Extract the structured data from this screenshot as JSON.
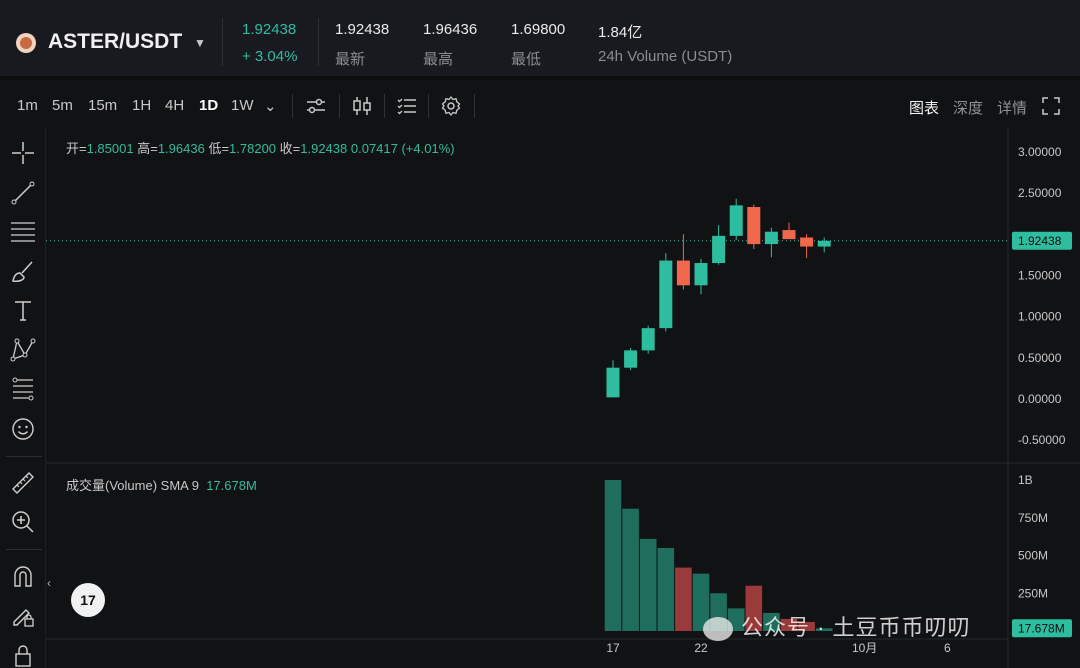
{
  "header": {
    "pair": "ASTER/USDT",
    "last_price": "1.92438",
    "change_pct": "+ 3.04%",
    "stats": [
      {
        "value": "1.92438",
        "label": "最新"
      },
      {
        "value": "1.96436",
        "label": "最高"
      },
      {
        "value": "1.69800",
        "label": "最低"
      },
      {
        "value": "1.84亿",
        "label": "24h Volume (USDT)"
      }
    ]
  },
  "toolbar": {
    "timeframes": [
      "1m",
      "5m",
      "15m",
      "1H",
      "4H",
      "1D",
      "1W"
    ],
    "active_timeframe": "1D",
    "view_tabs": [
      "图表",
      "深度",
      "详情"
    ],
    "active_view": "图表"
  },
  "legend": {
    "open_label": "开=",
    "open": "1.85001",
    "high_label": "高=",
    "high": "1.96436",
    "low_label": "低=",
    "low": "1.78200",
    "close_label": "收=",
    "close": "1.92438",
    "change": "0.07417 (+4.01%)"
  },
  "volume_legend": {
    "title": "成交量(Volume)",
    "sma_label": "SMA 9",
    "sma_value": "17.678M"
  },
  "price_axis": {
    "ticks": [
      "3.00000",
      "2.50000",
      "2.00000",
      "1.50000",
      "1.00000",
      "0.50000",
      "0.00000",
      "-0.50000"
    ],
    "current_label": "1.92438"
  },
  "volume_axis": {
    "ticks": [
      "1B",
      "750M",
      "500M",
      "250M"
    ],
    "current_label": "17.678M"
  },
  "time_axis": {
    "ticks": [
      "17",
      "22",
      "10月",
      "6"
    ]
  },
  "watermark": "公众号 · 土豆币币叨叨",
  "tv_logo": "17",
  "colors": {
    "up": "#2ebd9f",
    "down": "#f0674c",
    "vol_up": "#1f6d5c",
    "vol_down": "#9b3a3a",
    "background": "#111214",
    "header_bg": "#181a20"
  },
  "chart_data": {
    "type": "candlestick",
    "x": [
      "9-17",
      "9-18",
      "9-19",
      "9-20",
      "9-21",
      "9-22",
      "9-23",
      "9-24",
      "9-25",
      "9-26",
      "9-27",
      "9-28",
      "9-29"
    ],
    "series": [
      {
        "open": 0.02,
        "high": 0.47,
        "low": 0.02,
        "close": 0.38
      },
      {
        "open": 0.38,
        "high": 0.62,
        "low": 0.35,
        "close": 0.59
      },
      {
        "open": 0.59,
        "high": 0.89,
        "low": 0.55,
        "close": 0.86
      },
      {
        "open": 0.86,
        "high": 1.77,
        "low": 0.82,
        "close": 1.68
      },
      {
        "open": 1.68,
        "high": 2.0,
        "low": 1.33,
        "close": 1.38
      },
      {
        "open": 1.38,
        "high": 1.7,
        "low": 1.27,
        "close": 1.65
      },
      {
        "open": 1.65,
        "high": 2.11,
        "low": 1.63,
        "close": 1.98
      },
      {
        "open": 1.98,
        "high": 2.43,
        "low": 1.93,
        "close": 2.35
      },
      {
        "open": 2.33,
        "high": 2.36,
        "low": 1.82,
        "close": 1.88
      },
      {
        "open": 1.88,
        "high": 2.08,
        "low": 1.72,
        "close": 2.03
      },
      {
        "open": 2.05,
        "high": 2.14,
        "low": 1.95,
        "close": 1.94
      },
      {
        "open": 1.96,
        "high": 2.0,
        "low": 1.71,
        "close": 1.85
      },
      {
        "open": 1.85,
        "high": 1.96,
        "low": 1.78,
        "close": 1.92
      }
    ],
    "volume": [
      1000,
      810,
      610,
      550,
      420,
      380,
      250,
      150,
      300,
      120,
      80,
      60,
      18
    ],
    "volume_unit": "M",
    "ylim": [
      -0.5,
      3.0
    ]
  }
}
